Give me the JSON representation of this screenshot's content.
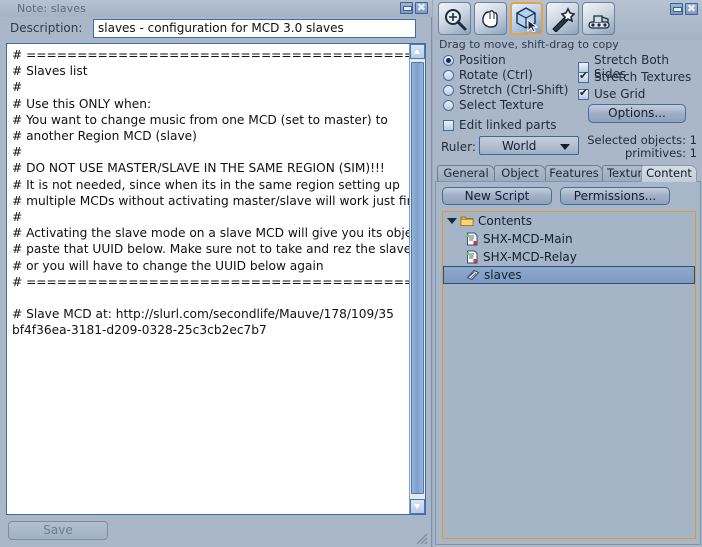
{
  "note_window": {
    "title": "Note: slaves",
    "description_label": "Description:",
    "description_value": "slaves - configuration for MCD 3.0 slaves",
    "body_text": "# ==========================================\n# Slaves list\n#\n# Use this ONLY when:\n# You want to change music from one MCD (set to master) to\n# another Region MCD (slave)\n#\n# DO NOT USE MASTER/SLAVE IN THE SAME REGION (SIM)!!!\n# It is not needed, since when its in the same region setting up\n# multiple MCDs without activating master/slave will work just fine\n#\n# Activating the slave mode on a slave MCD will give you its object UUID\n# paste that UUID below. Make sure not to take and rez the slave again\n# or you will have to change the UUID below again\n# ==========================================\n\n# Slave MCD at: http://slurl.com/secondlife/Mauve/178/109/35\nbf4f36ea-3181-d209-0328-25c3cb2ec7b7",
    "save_label": "Save",
    "minimize_label": "_",
    "close_label": "✖"
  },
  "build_window": {
    "hint_text": "Drag to move, shift-drag to copy",
    "minimize_label": "_",
    "close_label": "✖",
    "toolbar": [
      {
        "name": "zoom-tool",
        "selected": false
      },
      {
        "name": "grab-tool",
        "selected": false
      },
      {
        "name": "edit-tool",
        "selected": true
      },
      {
        "name": "create-tool",
        "selected": false
      },
      {
        "name": "land-tool",
        "selected": false
      }
    ],
    "radios": [
      {
        "label": "Position",
        "checked": true
      },
      {
        "label": "Rotate (Ctrl)",
        "checked": false
      },
      {
        "label": "Stretch (Ctrl-Shift)",
        "checked": false
      },
      {
        "label": "Select Texture",
        "checked": false
      }
    ],
    "edit_linked": {
      "label": "Edit linked parts",
      "checked": false
    },
    "checks": [
      {
        "label": "Stretch Both Sides",
        "checked": false
      },
      {
        "label": "Stretch Textures",
        "checked": true
      },
      {
        "label": "Use Grid",
        "checked": true
      }
    ],
    "options_label": "Options...",
    "ruler_label": "Ruler:",
    "ruler_value": "World",
    "selected_objects": "Selected objects: 1",
    "primitives": "primitives: 1",
    "tabs": [
      {
        "label": "General",
        "active": false
      },
      {
        "label": "Object",
        "active": false
      },
      {
        "label": "Features",
        "active": false
      },
      {
        "label": "Texture",
        "active": false
      },
      {
        "label": "Content",
        "active": true
      }
    ],
    "content": {
      "new_script_label": "New Script",
      "permissions_label": "Permissions...",
      "root_label": "Contents",
      "items": [
        {
          "label": "SHX-MCD-Main",
          "icon": "script-icon",
          "selected": false
        },
        {
          "label": "SHX-MCD-Relay",
          "icon": "script-icon",
          "selected": false
        },
        {
          "label": "slaves",
          "icon": "notecard-icon",
          "selected": true
        }
      ]
    }
  },
  "colors": {
    "window_bg": "#a9b7c8",
    "titlebar": "#b7c3d2",
    "field_border": "#3b6ea8",
    "accent_orange": "#e09a2d",
    "selection_blue": "#7d9ac0",
    "text_dark": "#14202e"
  }
}
